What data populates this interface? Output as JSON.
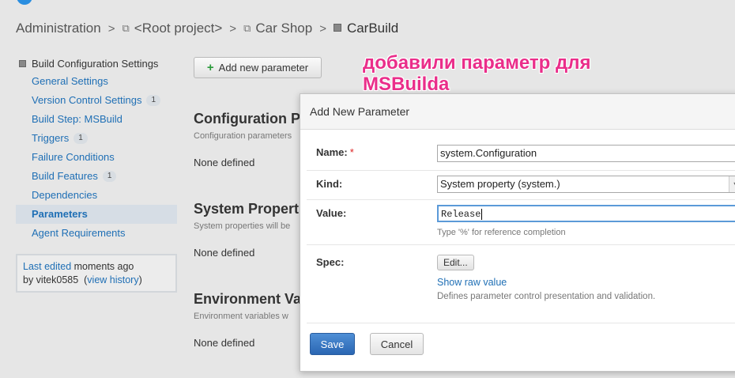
{
  "breadcrumb": {
    "admin": "Administration",
    "root": "<Root project>",
    "shop": "Car Shop",
    "current": "CarBuild",
    "sep": ">"
  },
  "sidebar": {
    "header": "Build Configuration Settings",
    "items": [
      {
        "label": "General Settings",
        "count": ""
      },
      {
        "label": "Version Control Settings",
        "count": "1"
      },
      {
        "label": "Build Step: MSBuild",
        "count": ""
      },
      {
        "label": "Triggers",
        "count": "1"
      },
      {
        "label": "Failure Conditions",
        "count": ""
      },
      {
        "label": "Build Features",
        "count": "1"
      },
      {
        "label": "Dependencies",
        "count": ""
      },
      {
        "label": "Parameters",
        "count": "",
        "active": true
      },
      {
        "label": "Agent Requirements",
        "count": ""
      }
    ],
    "edited": {
      "link": "Last edited",
      "time": " moments ago",
      "by": "by vitek0585",
      "history": "view history"
    }
  },
  "main": {
    "add_button": "Add new parameter",
    "sections": [
      {
        "title": "Configuration Parameters",
        "desc": "Configuration parameters",
        "none": "None defined"
      },
      {
        "title": "System Properties",
        "desc": "System properties will be",
        "none": "None defined"
      },
      {
        "title": "Environment Variables",
        "desc": "Environment variables w",
        "none": "None defined"
      }
    ]
  },
  "annotation": {
    "line1": "добавили параметр для",
    "line2": "MSBuilda"
  },
  "dialog": {
    "title": "Add New Parameter",
    "name_label": "Name:",
    "required_mark": "*",
    "name_value": "system.Configuration",
    "kind_label": "Kind:",
    "kind_value": "System property (system.)",
    "value_label": "Value:",
    "value_value": "Release",
    "value_hint": "Type '%' for reference completion",
    "spec_label": "Spec:",
    "edit_button": "Edit...",
    "show_raw": "Show raw value",
    "spec_hint": "Defines parameter control presentation and validation.",
    "save": "Save",
    "cancel": "Cancel"
  },
  "colors": {
    "link": "#1f6fb5",
    "annotation": "#ea2e8a",
    "save_button": "#2a66b2",
    "active_item_bg": "#d6dde5"
  }
}
